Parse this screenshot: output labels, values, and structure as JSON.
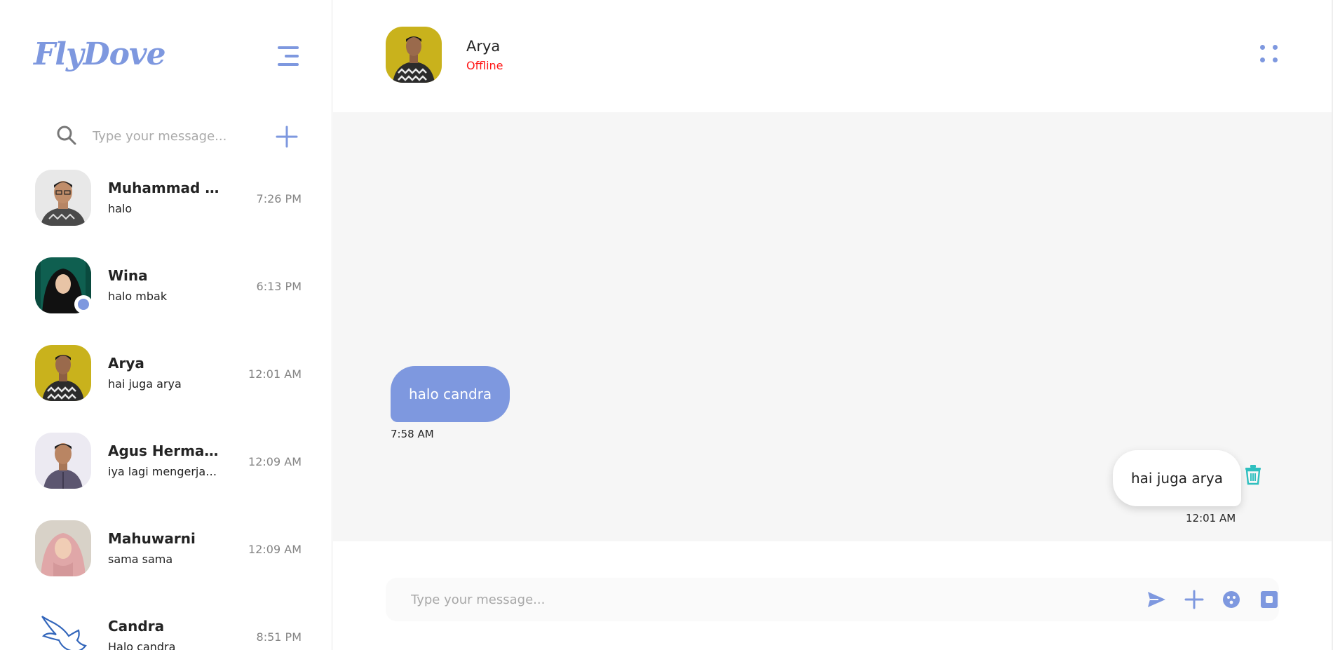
{
  "app": {
    "logo": "FlyDove"
  },
  "sidebar": {
    "search": {
      "placeholder": "Type your message..."
    },
    "contacts": [
      {
        "name": "Muhammad Risky",
        "message": "halo",
        "time": "7:26 PM",
        "avatar": "photo-man-glasses-batik",
        "online": false
      },
      {
        "name": "Wina",
        "message": "halo mbak",
        "time": "6:13 PM",
        "avatar": "photo-woman-hijab-black",
        "online": true
      },
      {
        "name": "Arya",
        "message": "hai juga arya",
        "time": "12:01 AM",
        "avatar": "photo-man-batik-yellow-bg",
        "online": false
      },
      {
        "name": "Agus Hermawan",
        "message": "iya lagi mengerjakan",
        "time": "12:09 AM",
        "avatar": "photo-man-purple-shirt",
        "online": false
      },
      {
        "name": "Mahuwarni",
        "message": "sama sama",
        "time": "12:09 AM",
        "avatar": "photo-woman-hijab-pink",
        "online": false
      },
      {
        "name": "Candra",
        "message": "Halo candra",
        "time": "8:51 PM",
        "avatar": "dove-logo",
        "online": false
      }
    ]
  },
  "chat": {
    "header": {
      "name": "Arya",
      "status": "Offline",
      "status_color": "#ff1717"
    },
    "messages": [
      {
        "direction": "incoming",
        "text": "halo candra",
        "time": "7:58 AM"
      },
      {
        "direction": "outgoing",
        "text": "hai juga arya",
        "time": "12:01 AM"
      }
    ],
    "composer": {
      "placeholder": "Type your message..."
    }
  },
  "icons": {
    "menu": "menu-icon",
    "search": "search-icon",
    "add": "plus-icon",
    "kebab": "dots-grid-icon",
    "trash": "trash-icon",
    "send": "send-icon",
    "attach": "plus-icon",
    "emoji": "emoji-icon",
    "camera": "camera-icon"
  },
  "colors": {
    "accent": "#7e98df",
    "chat_bg": "#f6f6f6",
    "offline": "#ff1717",
    "trash": "#2fbfbf"
  }
}
